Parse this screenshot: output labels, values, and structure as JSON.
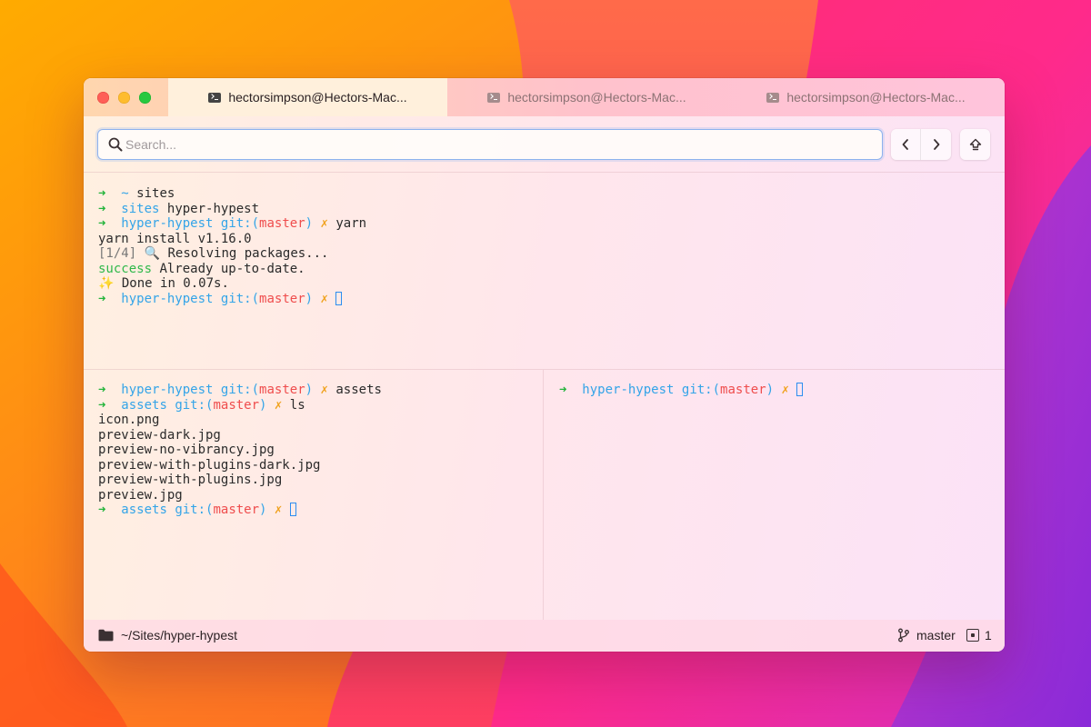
{
  "window": {
    "tabs": [
      {
        "label": "hectorsimpson@Hectors-Mac...",
        "active": true
      },
      {
        "label": "hectorsimpson@Hectors-Mac...",
        "active": false
      },
      {
        "label": "hectorsimpson@Hectors-Mac...",
        "active": false
      }
    ]
  },
  "toolbar": {
    "search_placeholder": "Search...",
    "search_value": ""
  },
  "panes": {
    "top": {
      "lines": [
        {
          "arrow": "➜",
          "dir": "~",
          "cmd": "sites"
        },
        {
          "arrow": "➜",
          "dir": "sites",
          "cmd": "hyper-hypest"
        },
        {
          "arrow": "➜",
          "dir": "hyper-hypest",
          "git_prefix": "git:(",
          "branch": "master",
          "git_suffix": ")",
          "dirty": "✗",
          "cmd": "yarn"
        },
        {
          "text": "yarn install v1.16.0"
        },
        {
          "step": "[1/4]",
          "icon": "🔍",
          "text": "Resolving packages..."
        },
        {
          "status": "success",
          "text": "Already up-to-date."
        },
        {
          "icon": "✨",
          "text": "Done in 0.07s."
        },
        {
          "arrow": "➜",
          "dir": "hyper-hypest",
          "git_prefix": "git:(",
          "branch": "master",
          "git_suffix": ")",
          "dirty": "✗"
        }
      ]
    },
    "bottom_left": {
      "lines": [
        {
          "arrow": "➜",
          "dir": "hyper-hypest",
          "git_prefix": "git:(",
          "branch": "master",
          "git_suffix": ")",
          "dirty": "✗",
          "cmd": "assets"
        },
        {
          "arrow": "➜",
          "dir": "assets",
          "git_prefix": "git:(",
          "branch": "master",
          "git_suffix": ")",
          "dirty": "✗",
          "cmd": "ls"
        },
        {
          "text": "icon.png"
        },
        {
          "text": "preview-dark.jpg"
        },
        {
          "text": "preview-no-vibrancy.jpg"
        },
        {
          "text": "preview-with-plugins-dark.jpg"
        },
        {
          "text": "preview-with-plugins.jpg"
        },
        {
          "text": "preview.jpg"
        },
        {
          "arrow": "➜",
          "dir": "assets",
          "git_prefix": "git:(",
          "branch": "master",
          "git_suffix": ")",
          "dirty": "✗"
        }
      ]
    },
    "bottom_right": {
      "lines": [
        {
          "arrow": "➜",
          "dir": "hyper-hypest",
          "git_prefix": "git:(",
          "branch": "master",
          "git_suffix": ")",
          "dirty": "✗"
        }
      ]
    }
  },
  "statusbar": {
    "cwd": "~/Sites/hyper-hypest",
    "branch": "master",
    "pane_count": "1"
  },
  "colors": {
    "arrow": "#22b33a",
    "dir": "#33a4e8",
    "branch": "#ef4d4d",
    "dirty": "#f0a21e",
    "success": "#2fb84a",
    "cursor": "#2c8df0"
  },
  "icons": {
    "tab": "terminal-icon",
    "search": "search-icon",
    "prev": "chevron-left-icon",
    "next": "chevron-right-icon",
    "up": "arrow-up-icon",
    "folder": "folder-icon",
    "branch": "git-branch-icon",
    "pane": "pane-icon"
  }
}
